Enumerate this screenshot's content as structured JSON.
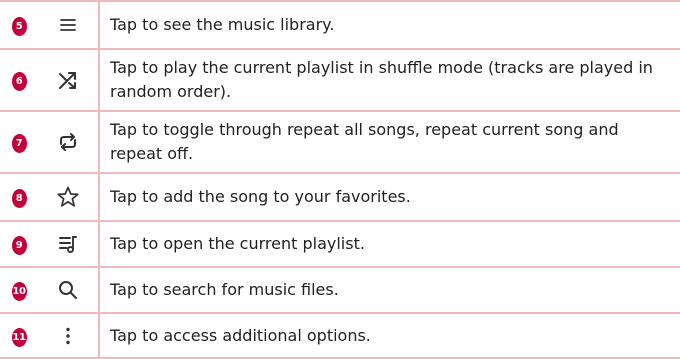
{
  "rows": [
    {
      "num": "5",
      "icon": "menu-icon",
      "text": "Tap to see the music library."
    },
    {
      "num": "6",
      "icon": "shuffle-icon",
      "text": "Tap to play the current playlist in shuffle mode (tracks are played in random order)."
    },
    {
      "num": "7",
      "icon": "repeat-icon",
      "text": "Tap to toggle through repeat all songs, repeat current song and repeat off."
    },
    {
      "num": "8",
      "icon": "star-icon",
      "text": "Tap to add the song to your favorites."
    },
    {
      "num": "9",
      "icon": "playlist-icon",
      "text": "Tap to open the current playlist."
    },
    {
      "num": "10",
      "icon": "search-icon",
      "text": "Tap to search for music files."
    },
    {
      "num": "11",
      "icon": "more-options-icon",
      "text": "Tap to access additional options."
    }
  ],
  "colors": {
    "border": "#f2b8bf",
    "badge": "#c4003a",
    "icon": "#333333"
  }
}
